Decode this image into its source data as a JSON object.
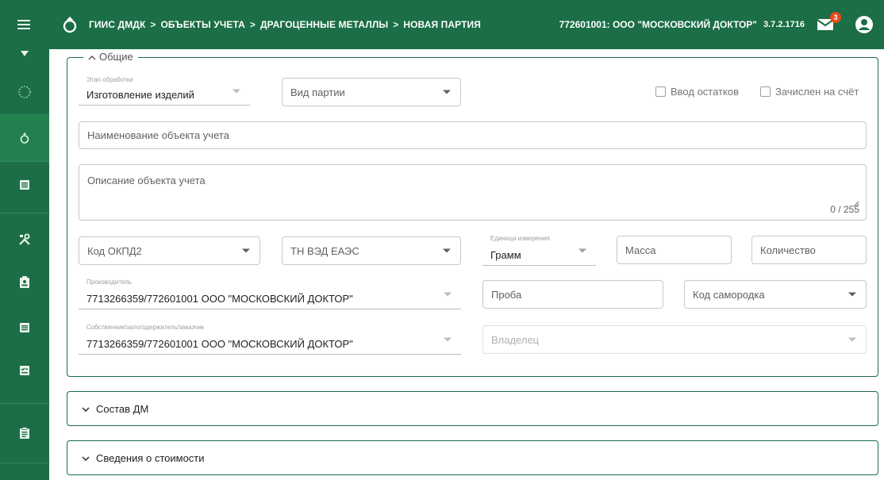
{
  "header": {
    "breadcrumbs": [
      "ГИИС ДМДК",
      "ОБЪЕКТЫ УЧЕТА",
      "ДРАГОЦЕННЫЕ МЕТАЛЛЫ",
      "НОВАЯ ПАРТИЯ"
    ],
    "separator": ">",
    "organization": "772601001: ООО \"МОСКОВСКИЙ ДОКТОР\"",
    "version": "3.7.2.1716",
    "notifications_count": "3"
  },
  "sidebar": {
    "icons": [
      "menu-icon",
      "download-icon",
      "circle-outline-icon",
      "ring-icon",
      "list-icon",
      "tools-icon",
      "badge-icon",
      "document-list-icon",
      "checklist-icon",
      "clipboard-icon"
    ]
  },
  "form": {
    "legend": "Общие",
    "processing_stage": {
      "label": "Этап обработки",
      "value": "Изготовление изделий"
    },
    "batch_type": {
      "placeholder": "Вид партии"
    },
    "checkbox_balance": "Ввод остатков",
    "checkbox_credited": "Зачислен на счёт",
    "object_name": {
      "placeholder": "Наименование объекта учета"
    },
    "object_description": {
      "placeholder": "Описание объекта учета",
      "counter": "0 / 255"
    },
    "okpd2": {
      "placeholder": "Код ОКПД2"
    },
    "tnved": {
      "placeholder": "ТН ВЭД ЕАЭС"
    },
    "unit": {
      "label": "Единица измерения",
      "value": "Грамм"
    },
    "mass": {
      "placeholder": "Масса"
    },
    "quantity": {
      "placeholder": "Количество"
    },
    "manufacturer": {
      "label": "Производитель",
      "value": "7713266359/772601001 ООО \"МОСКОВСКИЙ ДОКТОР\""
    },
    "assay": {
      "placeholder": "Проба"
    },
    "nugget_code": {
      "placeholder": "Код самородка"
    },
    "owner_customer": {
      "label": "Собственник/залогодержатель/заказчик",
      "value": "7713266359/772601001 ООО \"МОСКОВСКИЙ ДОКТОР\""
    },
    "owner": {
      "placeholder": "Владелец"
    }
  },
  "sections": {
    "composition": "Состав ДМ",
    "cost": "Сведения о стоимости"
  },
  "colors": {
    "primary": "#1b6e45",
    "badge": "#e64a19"
  }
}
